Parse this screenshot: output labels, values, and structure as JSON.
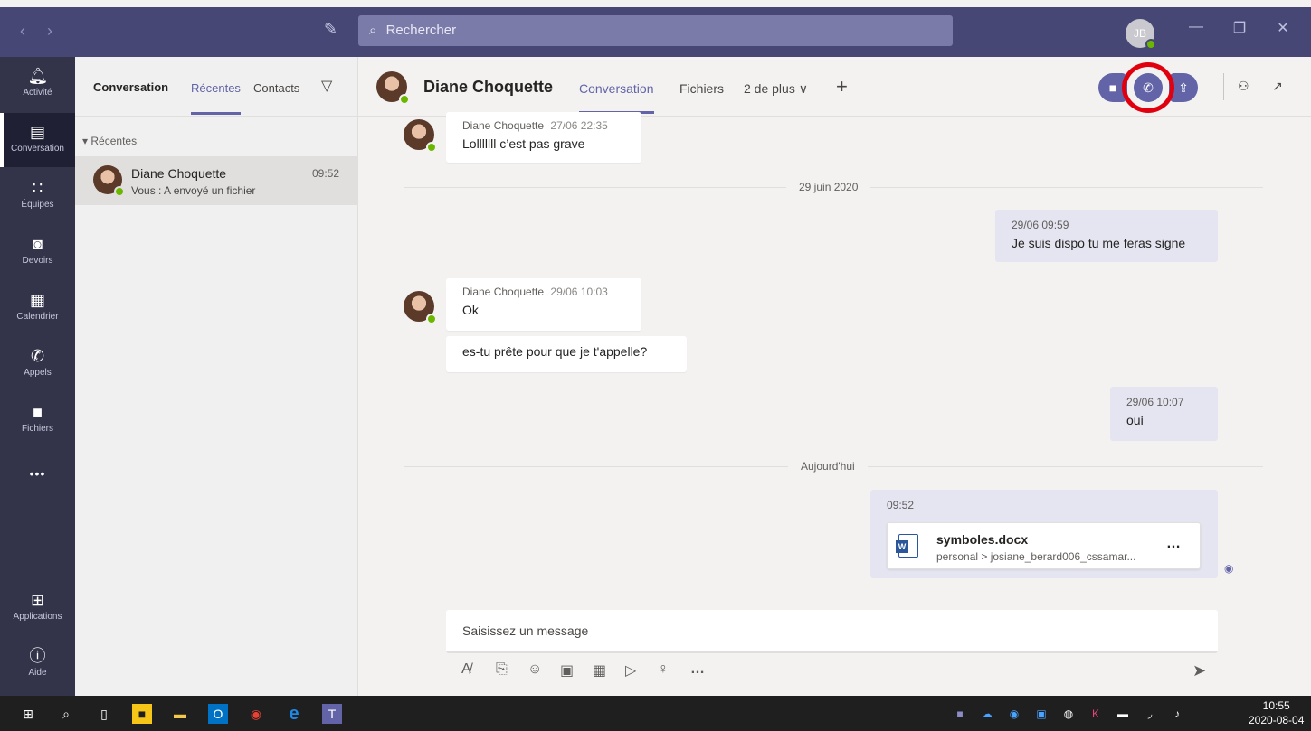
{
  "titlebar": {
    "search_placeholder": "Rechercher",
    "user_initials": "JB"
  },
  "rail": {
    "items": [
      {
        "label": "Activité",
        "icon": "bell-icon"
      },
      {
        "label": "Conversation",
        "icon": "chat-icon"
      },
      {
        "label": "Équipes",
        "icon": "teams-icon"
      },
      {
        "label": "Devoirs",
        "icon": "backpack-icon"
      },
      {
        "label": "Calendrier",
        "icon": "calendar-icon"
      },
      {
        "label": "Appels",
        "icon": "phone-icon"
      },
      {
        "label": "Fichiers",
        "icon": "file-icon"
      },
      {
        "label": "Applications",
        "icon": "apps-icon"
      },
      {
        "label": "Aide",
        "icon": "help-icon"
      }
    ],
    "more": "•••"
  },
  "chatlist": {
    "title": "Conversation",
    "tabs": [
      "Récentes",
      "Contacts"
    ],
    "group": "Récentes",
    "chats": [
      {
        "name": "Diane Choquette",
        "preview": "Vous : A envoyé un fichier",
        "time": "09:52"
      }
    ]
  },
  "header": {
    "contact": "Diane Choquette",
    "tabs": [
      "Conversation",
      "Fichiers",
      "2 de plus"
    ]
  },
  "messages": {
    "m1": {
      "sender": "Diane Choquette",
      "ts": "27/06 22:35",
      "text": "Lolllllll c’est pas grave"
    },
    "d1": "29 juin 2020",
    "m2": {
      "ts": "29/06 09:59",
      "text": "Je suis dispo tu me feras signe"
    },
    "m3": {
      "sender": "Diane Choquette",
      "ts": "29/06 10:03",
      "text": "Ok"
    },
    "m4": {
      "text": "es-tu prête pour que je t'appelle?"
    },
    "m5": {
      "ts": "29/06 10:07",
      "text": "oui"
    },
    "d2": "Aujourd'hui",
    "m6": {
      "ts": "09:52",
      "file_name": "symboles.docx",
      "file_path": "personal > josiane_berard006_cssamar..."
    }
  },
  "compose": {
    "placeholder": "Saisissez un message"
  },
  "taskbar": {
    "time": "10:55",
    "date": "2020-08-04"
  },
  "colors": {
    "accent": "#6264a7",
    "titlebar": "#464775",
    "rail": "#33344a",
    "highlight": "#e0000e",
    "presence": "#6bb700"
  }
}
